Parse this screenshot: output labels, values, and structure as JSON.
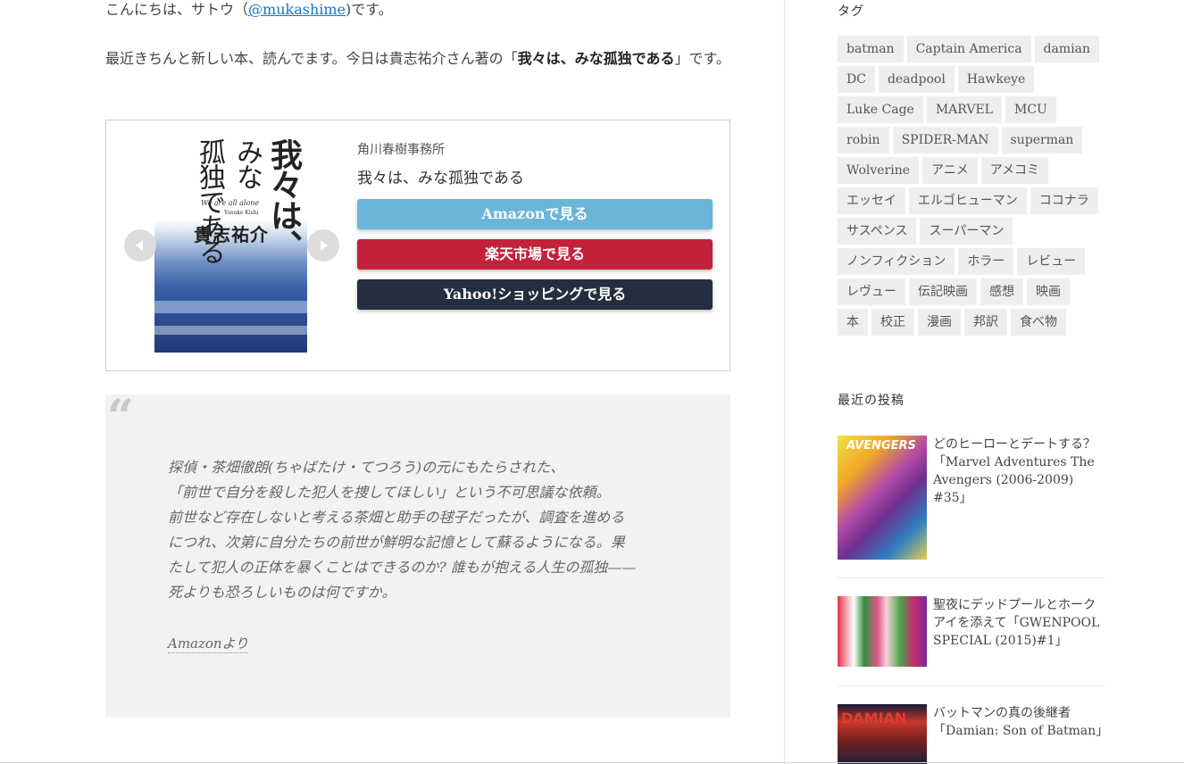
{
  "article": {
    "greeting_prefix": "こんにちは、サトウ（",
    "twitter_handle": "@mukashime",
    "greeting_suffix": ")です。",
    "intro_prefix": "最近きちんと新しい本、読んでます。今日は貴志祐介さん著の「",
    "intro_book": "我々は、みな孤独である",
    "intro_suffix": "」です。"
  },
  "product": {
    "publisher": "角川春樹事務所",
    "title": "我々は、みな孤独である",
    "cover_title_lines": [
      "我々は、",
      "みな",
      "孤独である"
    ],
    "cover_english": "We are all alone",
    "cover_romaji": "Yusuke Kishi",
    "cover_author": "貴志祐介",
    "buttons": {
      "amazon": "Amazonで見る",
      "rakuten": "楽天市場で見る",
      "yahoo": "Yahoo!ショッピングで見る"
    },
    "colors": {
      "amazon": "#6bb6d8",
      "rakuten": "#c4213a",
      "yahoo": "#232f3e"
    }
  },
  "quote": {
    "mark": "“",
    "lines": [
      "探偵・茶畑徹朗(ちゃばたけ・てつろう)の元にもたらされた、",
      "「前世で自分を殺した犯人を捜してほしい」という不可思議な依頼。",
      "前世など存在しないと考える茶畑と助手の毬子だったが、調査を進める",
      "につれ、次第に自分たちの前世が鮮明な記憶として蘇るようになる。果",
      "たして犯人の正体を暴くことはできるのか? 誰もが抱える人生の孤独——",
      "死よりも恐ろしいものは何ですか。"
    ],
    "cite": "Amazonより"
  },
  "sidebar": {
    "tags_title": "タグ",
    "tags": [
      "batman",
      "Captain America",
      "damian",
      "DC",
      "deadpool",
      "Hawkeye",
      "Luke Cage",
      "MARVEL",
      "MCU",
      "robin",
      "SPIDER-MAN",
      "superman",
      "Wolverine",
      "アニメ",
      "アメコミ",
      "エッセイ",
      "エルゴヒューマン",
      "ココナラ",
      "サスペンス",
      "スーパーマン",
      "ノンフィクション",
      "ホラー",
      "レビュー",
      "レヴュー",
      "伝記映画",
      "感想",
      "映画",
      "本",
      "校正",
      "漫画",
      "邦訳",
      "食べ物"
    ],
    "recent_title": "最近の投稿",
    "posts": [
      {
        "title": "どのヒーローとデートする？「Marvel Adventures The Avengers (2006-2009) #35」",
        "thumb_label": "AVENGERS"
      },
      {
        "title": "聖夜にデッドプールとホークアイを添えて「GWENPOOL SPECIAL (2015)#1」",
        "thumb_label": ""
      },
      {
        "title": "バットマンの真の後継者「Damian: Son of Batman」",
        "thumb_label": "DAMIAN"
      }
    ]
  }
}
